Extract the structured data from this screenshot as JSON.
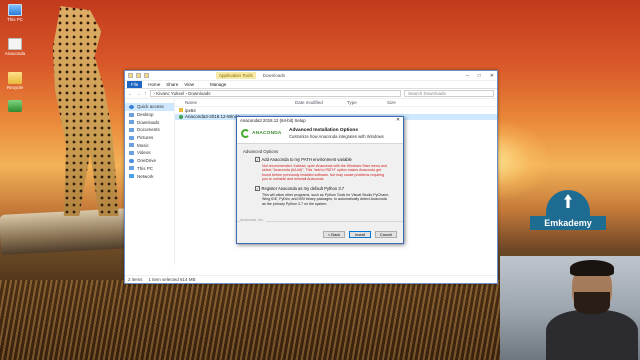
{
  "desktop": {
    "icons": [
      {
        "label": "This PC"
      },
      {
        "label": "Anaconda"
      },
      {
        "label": "Recycle"
      },
      {
        "label": ""
      }
    ]
  },
  "explorer": {
    "context_tab": "Application Tools",
    "title": "Downloads",
    "ribbon_tabs": [
      "File",
      "Home",
      "Share",
      "View"
    ],
    "manage_tab": "Manage",
    "address": "› Kivanc Yuksel › Downloads",
    "search_placeholder": "Search Downloads",
    "nav": [
      {
        "label": "Quick access",
        "icon": "star-icon"
      },
      {
        "label": "Desktop",
        "icon": "desktop-icon"
      },
      {
        "label": "Downloads",
        "icon": "download-icon"
      },
      {
        "label": "Documents",
        "icon": "documents-icon"
      },
      {
        "label": "Pictures",
        "icon": "pictures-icon"
      },
      {
        "label": "Music",
        "icon": "music-icon"
      },
      {
        "label": "Videos",
        "icon": "videos-icon"
      },
      {
        "label": "OneDrive",
        "icon": "cloud-icon"
      },
      {
        "label": "This PC",
        "icon": "pc-icon"
      },
      {
        "label": "Network",
        "icon": "network-icon"
      }
    ],
    "columns": [
      "Name",
      "Date modified",
      "Type",
      "Size"
    ],
    "files": [
      {
        "name": "ipx64",
        "icon": "folder-icon"
      },
      {
        "name": "Anaconda3-2018.12-Windo...",
        "icon": "installer-icon"
      }
    ],
    "status_items": "2 items",
    "status_selected": "1 item selected  614 MB"
  },
  "dialog": {
    "title": "Anaconda3 2018.12 (64-bit) Setup",
    "logo_text": "ANACONDA",
    "header_title": "Advanced Installation Options",
    "header_subtitle": "Customize how Anaconda integrates with Windows",
    "section_label": "Advanced Options",
    "option1_label": "Add Anaconda to my PATH environment variable",
    "option1_checked": true,
    "option1_note": "Not recommended. Instead, open Anaconda with the Windows Start menu and select \"Anaconda (64-bit)\". This \"add to PATH\" option makes Anaconda get found before previously installed software, but may cause problems requiring you to uninstall and reinstall Anaconda.",
    "option2_label": "Register Anaconda as my default Python 3.7",
    "option2_checked": true,
    "option2_note": "This will allow other programs, such as Python Tools for Visual Studio PyCharm, Wing IDE, PyDev, and MSI binary packages, to automatically detect Anaconda as the primary Python 3.7 on the system.",
    "brand": "Anaconda, Inc.",
    "back_label": "< Back",
    "install_label": "Install",
    "cancel_label": "Cancel",
    "note_color": "#d11b1b"
  },
  "badge": {
    "text": "Emkademy"
  }
}
